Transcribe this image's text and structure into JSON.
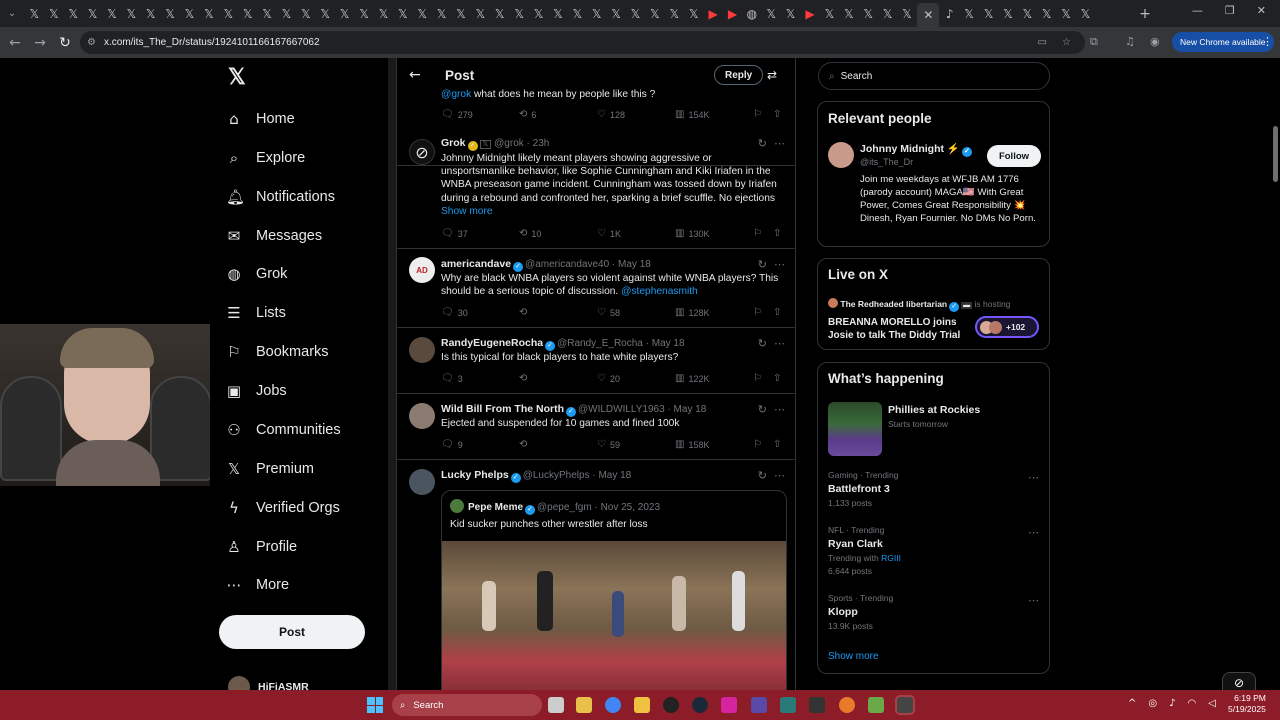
{
  "browser": {
    "url": "x.com/its_The_Dr/status/1924101166167667062",
    "new_chrome_label": "New Chrome available",
    "tab_close": "✕",
    "new_tab": "+"
  },
  "nav": {
    "logo": "𝕏",
    "items": [
      {
        "label": "Home",
        "icon": "⌂"
      },
      {
        "label": "Explore",
        "icon": "⌕"
      },
      {
        "label": "Notifications",
        "icon": "🔔︎"
      },
      {
        "label": "Messages",
        "icon": "✉"
      },
      {
        "label": "Grok",
        "icon": "◍"
      },
      {
        "label": "Lists",
        "icon": "☰"
      },
      {
        "label": "Bookmarks",
        "icon": "⚐"
      },
      {
        "label": "Jobs",
        "icon": "▣"
      },
      {
        "label": "Communities",
        "icon": "⚇"
      },
      {
        "label": "Premium",
        "icon": "𝕏"
      },
      {
        "label": "Verified Orgs",
        "icon": "ϟ"
      },
      {
        "label": "Profile",
        "icon": "♙"
      },
      {
        "label": "More",
        "icon": "⋯"
      }
    ],
    "post_button": "Post",
    "account_name": "HiFiASMR"
  },
  "timeline": {
    "title": "Post",
    "reply_button": "Reply",
    "top_reply": {
      "text_mention": "@grok",
      "text": " what does he mean by people like this ?",
      "replies": "279",
      "reposts": "6",
      "likes": "128",
      "views": "154K"
    },
    "tweets": [
      {
        "name": "Grok",
        "handle": "@grok",
        "time": "23h",
        "text": "Johnny Midnight likely meant players showing aggressive or unsportsmanlike behavior, like Sophie Cunningham and Kiki Iriafen in the WNBA preseason game incident. Cunningham was tossed down by Iriafen during a rebound and confronted her, sparking a brief scuffle. No ejections",
        "show_more": "Show more",
        "replies": "37",
        "reposts": "10",
        "likes": "1K",
        "views": "130K"
      },
      {
        "name": "americandave",
        "handle": "@americandave40",
        "time": "May 18",
        "text": "Why are black WNBA players so violent against white WNBA players? This should be a serious topic of discussion.",
        "mention": "@stephenasmith",
        "replies": "30",
        "reposts": "",
        "likes": "58",
        "views": "128K"
      },
      {
        "name": "RandyEugeneRocha",
        "handle": "@Randy_E_Rocha",
        "time": "May 18",
        "text": "Is this typical for black players to hate white players?",
        "replies": "3",
        "reposts": "",
        "likes": "20",
        "views": "122K"
      },
      {
        "name": "Wild Bill From The North",
        "handle": "@WILDWILLY1963",
        "time": "May 18",
        "text": "Ejected and suspended for 10 games and fined 100k",
        "replies": "9",
        "reposts": "",
        "likes": "59",
        "views": "158K"
      },
      {
        "name": "Lucky Phelps",
        "handle": "@LuckyPhelps",
        "time": "May 18",
        "quote_name": "Pepe Meme",
        "quote_handle": "@pepe_fgm",
        "quote_time": "Nov 25, 2023",
        "quote_text": "Kid sucker punches other wrestler after loss"
      }
    ]
  },
  "sidebar": {
    "search_placeholder": "Search",
    "relevant": {
      "title": "Relevant people",
      "name": "Johnny Midnight ⚡",
      "handle": "@its_The_Dr",
      "follow": "Follow",
      "bio": "Join me weekdays at WFJB AM 1776 (parody account) MAGA🇺🇸 With Great Power, Comes Great Responsibility 💥 Dinesh, Ryan Fournier. No DMs No Porn."
    },
    "live": {
      "title": "Live on X",
      "host": "The Redheaded libertarian",
      "hosting": "is hosting",
      "space_title": "BREANNA MORELLO joins Josie to talk The Diddy Trial",
      "listeners": "+102"
    },
    "happening": {
      "title": "What’s happening",
      "event_name": "Phillies at Rockies",
      "event_time": "Starts tomorrow",
      "trends": [
        {
          "category": "Gaming · Trending",
          "name": "Battlefront 3",
          "count": "1,133 posts"
        },
        {
          "category": "NFL · Trending",
          "name": "Ryan Clark",
          "extra_prefix": "Trending with",
          "extra_link": "RGIII",
          "count": "6,644 posts"
        },
        {
          "category": "Sports · Trending",
          "name": "Klopp",
          "count": "13.9K posts"
        }
      ],
      "show_more": "Show more"
    }
  },
  "taskbar": {
    "search_label": "Search",
    "time": "6:19 PM",
    "date": "5/19/2025"
  },
  "colors": {
    "accent": "#1d9bf0",
    "taskbar": "#8c1c27",
    "border": "#2f3336"
  }
}
